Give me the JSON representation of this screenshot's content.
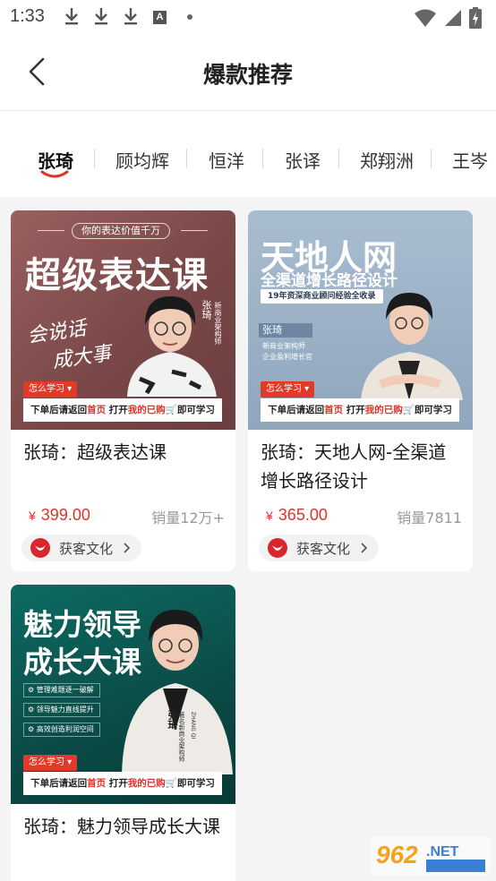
{
  "status_bar": {
    "time": "1:33"
  },
  "header": {
    "title": "爆款推荐"
  },
  "tabs": [
    {
      "label": "张琦"
    },
    {
      "label": "顾均辉"
    },
    {
      "label": "恒洋"
    },
    {
      "label": "张译"
    },
    {
      "label": "郑翔洲"
    },
    {
      "label": "王岑"
    }
  ],
  "thumb_common": {
    "how_label": "怎么学习",
    "notice_pre": "下单后请返回",
    "notice_home": "首页",
    "notice_mid": " 打开",
    "notice_mine": "我的已购",
    "notice_post": "即可学习"
  },
  "products": [
    {
      "title": "张琦：超级表达课",
      "price_symbol": "¥",
      "price": "399.00",
      "sales": "销量12万+",
      "shop": "获客文化",
      "thumb": {
        "tagline": "你的表达价值千万",
        "headline": "超级表达课",
        "calligraphy_1": "会说话",
        "calligraphy_2": "成大事",
        "name": "张琦",
        "role": "新商业架构师"
      }
    },
    {
      "title": "张琦：天地人网-全渠道增长路径设计",
      "price_symbol": "¥",
      "price": "365.00",
      "sales": "销量7811",
      "shop": "获客文化",
      "thumb": {
        "headline": "天地人网",
        "subhead": "全渠道增长路径设计",
        "ribbon": "19年资深商业顾问经验全收录",
        "name": "张琦",
        "role_1": "新商业架构师",
        "role_2": "企业盈利增长官"
      }
    },
    {
      "title": "张琦：魅力领导成长大课",
      "thumb": {
        "headline_1": "魅力领导",
        "headline_2": "成长大课",
        "bullets": [
          "管理难题逐一破解",
          "领导魅力直线提升",
          "高效创造利润空间"
        ],
        "name": "张琦",
        "role": "著名新商业架构师",
        "name_en": "ZHANG QI"
      }
    }
  ],
  "colors": {
    "accent": "#e0322a",
    "thumb1_bg": "#8c5656",
    "thumb2_bg": "#98aec4",
    "thumb3_bg": "#0f5a54"
  }
}
